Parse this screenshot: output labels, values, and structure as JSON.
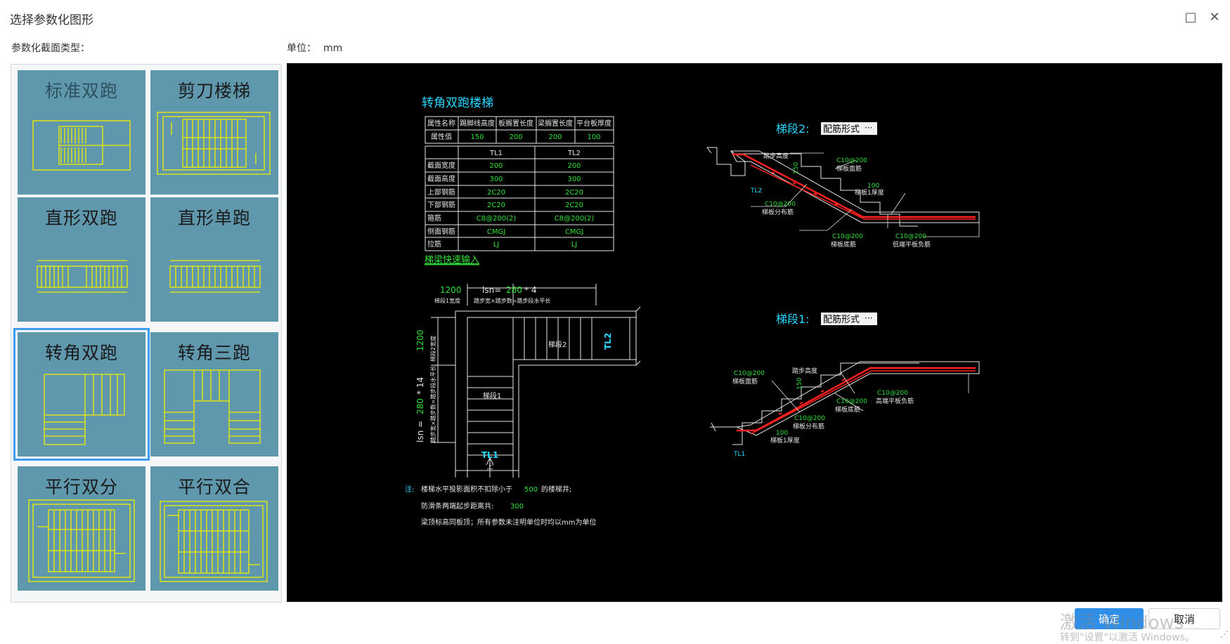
{
  "dialog": {
    "title": "选择参数化图形",
    "section_label": "参数化截面类型：",
    "unit_label": "单位：",
    "unit_value": "mm"
  },
  "tiles": [
    {
      "label": "标准双跑"
    },
    {
      "label": "剪刀楼梯"
    },
    {
      "label": "直形双跑"
    },
    {
      "label": "直形单跑"
    },
    {
      "label": "转角双跑",
      "selected": true
    },
    {
      "label": "转角三跑"
    },
    {
      "label": "平行双分"
    },
    {
      "label": "平行双合"
    }
  ],
  "preview": {
    "title": "转角双跑楼梯",
    "props_table": {
      "headers": [
        "属性名称",
        "踢脚线高度",
        "板搁置长度",
        "梁搁置长度",
        "平台板厚度"
      ],
      "row_label": "属性值",
      "values": [
        "150",
        "200",
        "200",
        "100"
      ]
    },
    "beam_table": {
      "columns": [
        "TL1",
        "TL2"
      ],
      "rows": [
        {
          "label": "截面宽度",
          "v1": "200",
          "v2": "200"
        },
        {
          "label": "截面高度",
          "v1": "300",
          "v2": "300"
        },
        {
          "label": "上部钢筋",
          "v1": "2C20",
          "v2": "2C20"
        },
        {
          "label": "下部钢筋",
          "v1": "2C20",
          "v2": "2C20"
        },
        {
          "label": "箍筋",
          "v1": "C8@200(2)",
          "v2": "C8@200(2)"
        },
        {
          "label": "侧面钢筋",
          "v1": "CMGJ",
          "v2": "CMGJ"
        },
        {
          "label": "拉筋",
          "v1": "LJ",
          "v2": "LJ"
        }
      ]
    },
    "quick_input_link": "梯梁快速输入",
    "plan": {
      "dim_top_1": "1200",
      "dim_top_2_prefix": "lsn=",
      "dim_top_2_value": "280",
      "dim_top_2_suffix": "* 4",
      "dim_top_1_note": "梯段1宽度",
      "dim_top_2_note": "踏步宽×踏步数=踏步段水平长",
      "dim_left_1": "1200",
      "dim_left_1_note": "梯段2宽度",
      "dim_left_2_prefix": "lsn =",
      "dim_left_2_value": "280",
      "dim_left_2_suffix": "* 14",
      "dim_left_2_note": "踏步宽×踏步数=踏步段水平长",
      "flight2": "梯段2",
      "flight1": "梯段1",
      "tl1": "TL1",
      "tl2": "TL2",
      "up": "上"
    },
    "notes": {
      "prefix": "注:",
      "line1_a": "楼梯水平投影面积不扣除小于",
      "line1_val": "500",
      "line1_b": "的楼梯井;",
      "line2_a": "防滑条两端起步距离共:",
      "line2_val": "300",
      "line3": "梁顶标高同板顶；所有参数未注明单位时均以mm为单位"
    },
    "flight2_section": {
      "label": "梯段2:",
      "select_value": "配筋形式",
      "riser": "踏步高度",
      "riser_val": "150",
      "top_rebar": "C10@200",
      "top_rebar_note": "梯板面筋",
      "thick_val": "100",
      "thick_note": "梯板1厚度",
      "dist_rebar": "C10@200",
      "dist_rebar_note": "梯板分布筋",
      "bottom_rebar": "C10@200",
      "bottom_rebar_note": "梯板底筋",
      "slab_rebar": "C10@200",
      "slab_rebar_note": "低端平板负筋",
      "beam": "TL2"
    },
    "flight1_section": {
      "label": "梯段1:",
      "select_value": "配筋形式",
      "top_rebar": "C10@200",
      "top_rebar_note": "梯板面筋",
      "riser": "踏步高度",
      "riser_val": "150",
      "bottom_rebar": "C10@200",
      "bottom_rebar_note": "梯板底筋",
      "slab_rebar": "C10@200",
      "slab_rebar_note": "高端平板负筋",
      "dist_rebar": "C10@200",
      "dist_rebar_note": "梯板分布筋",
      "thick_val": "100",
      "thick_note": "梯板1厚度",
      "beam": "TL1"
    }
  },
  "buttons": {
    "ok": "确定",
    "cancel": "取消"
  },
  "watermark": {
    "line1": "激活 Windows",
    "line2": "转到\"设置\"以激活 Windows。"
  },
  "colors": {
    "tile_bg": "#5f97ac",
    "cad_bg": "#000000",
    "cyan": "#27d8ff",
    "green": "#32e23a",
    "rebar_red": "#ff2020",
    "accent": "#2f8fe8"
  }
}
